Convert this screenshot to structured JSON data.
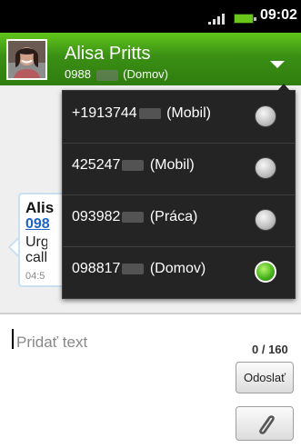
{
  "status_bar": {
    "time": "09:02"
  },
  "header": {
    "contact_name": "Alisa Pritts",
    "contact_number": "0988",
    "contact_number_type": "(Domov)"
  },
  "thread": {
    "message": {
      "sender": "Alis",
      "number": "098",
      "text_line1": "Urg",
      "text_line2": "call",
      "time": "04:5"
    }
  },
  "number_menu": {
    "items": [
      {
        "number": "+1913744",
        "type": "(Mobil)",
        "selected": false
      },
      {
        "number": "425247",
        "type": "(Mobil)",
        "selected": false
      },
      {
        "number": "093982",
        "type": "(Práca)",
        "selected": false
      },
      {
        "number": "098817",
        "type": "(Domov)",
        "selected": true
      }
    ]
  },
  "composer": {
    "placeholder": "Pridať text",
    "counter": "0 / 160",
    "send_label": "Odoslať"
  },
  "colors": {
    "header_green": "#3a8f14",
    "selected_radio": "#45b11b",
    "link_blue": "#1f61c4",
    "menu_background": "#242424"
  },
  "icons": {
    "signal": "signal-bars-icon",
    "battery": "battery-icon",
    "dropdown": "chevron-down-icon",
    "attach": "paperclip-icon",
    "contact": "contact-photo"
  }
}
